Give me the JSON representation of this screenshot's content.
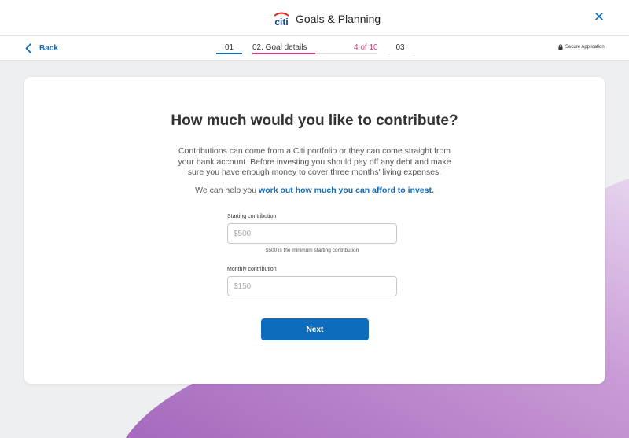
{
  "header": {
    "logo_text": "citi",
    "title": "Goals & Planning",
    "close_label": "✕"
  },
  "subnav": {
    "back_label": "Back",
    "steps": [
      {
        "label": "01"
      },
      {
        "label": "02. Goal details"
      },
      {
        "label": "03"
      }
    ],
    "step_count": "4 of 10",
    "progress_fraction": 0.5,
    "secure_label": "Secure Application"
  },
  "main": {
    "title": "How much would you like to contribute?",
    "description": "Contributions can come from a Citi portfolio or they can come straight from your bank account.  Before investing you should pay off any debt and make sure you have enough money to cover three months' living expenses.",
    "help_prefix": "We can help you ",
    "help_link": "work out how much you can afford to invest.",
    "starting": {
      "label": "Starting contribution",
      "placeholder": "$500",
      "value": "",
      "hint": "$500 is the minimum starting contribution"
    },
    "monthly": {
      "label": "Monthly contribution",
      "placeholder": "$150",
      "value": ""
    },
    "next_label": "Next"
  },
  "colors": {
    "brand_blue": "#0f6cbd",
    "accent_pink": "#d8398a",
    "swoosh_purple": "#b57bc9"
  }
}
